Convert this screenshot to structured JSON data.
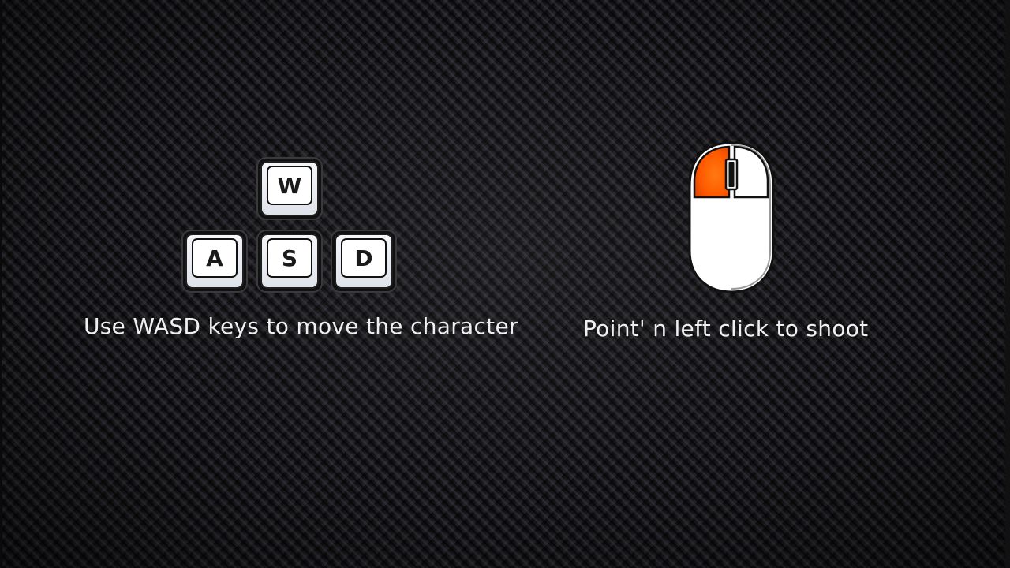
{
  "keys": {
    "w": "W",
    "a": "A",
    "s": "S",
    "d": "D"
  },
  "movement_caption": "Use WASD keys to move the character",
  "shoot_caption": "Point' n left click to shoot",
  "colors": {
    "left_click_highlight": "#ff5a00",
    "key_face": "#ffffff",
    "mouse_body": "#ffffff"
  },
  "icons": {
    "keys": "wasd-keys-icon",
    "mouse": "mouse-icon"
  }
}
